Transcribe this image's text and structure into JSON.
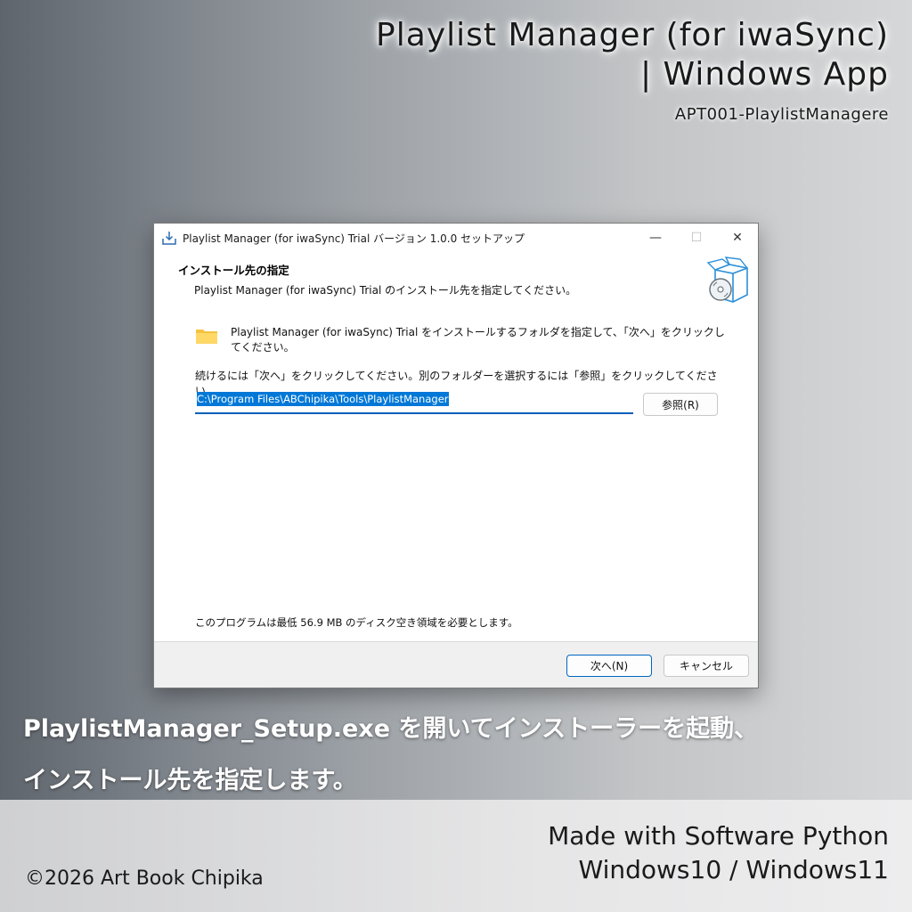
{
  "header": {
    "title_line1": "Playlist Manager (for iwaSync)",
    "title_line2": "| Windows App",
    "code": "APT001-PlaylistManagere"
  },
  "window": {
    "title": "Playlist Manager (for iwaSync) Trial バージョン 1.0.0 セットアップ",
    "minimize_glyph": "—",
    "maximize_glyph": "☐",
    "close_glyph": "✕",
    "heading": "インストール先の指定",
    "subheading": "Playlist Manager (for iwaSync) Trial のインストール先を指定してください。",
    "intro": "Playlist Manager (for iwaSync) Trial をインストールするフォルダを指定して、「次へ」をクリックしてください。",
    "instruction": "続けるには「次へ」をクリックしてください。別のフォルダーを選択するには「参照」をクリックしてください。",
    "path_value": "C:\\Program Files\\ABChipika\\Tools\\PlaylistManager",
    "browse_label": "参照(R)",
    "disk_space": "このプログラムは最低 56.9 MB のディスク空き領域を必要とします。",
    "next_label": "次へ(N)",
    "cancel_label": "キャンセル"
  },
  "caption": {
    "line1": "PlaylistManager_Setup.exe を開いてインストーラーを起動、",
    "line2": "インストール先を指定します。"
  },
  "footer": {
    "made_line1": "Made with Software Python",
    "made_line2": "Windows10 / Windows11",
    "copyright": "©2026 Art Book Chipika"
  },
  "colors": {
    "accent": "#0067c0",
    "selection": "#0078d7",
    "folder": "#f5c342"
  },
  "icons": [
    "installer-icon",
    "box-cd-icon",
    "folder-icon"
  ]
}
